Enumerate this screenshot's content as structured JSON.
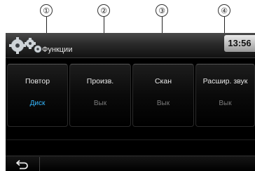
{
  "callouts": [
    "①",
    "②",
    "③",
    "④"
  ],
  "header": {
    "title": "Функции",
    "clock": "13:56"
  },
  "options": [
    {
      "label": "Повтор",
      "value": "Диск",
      "active": true
    },
    {
      "label": "Произв.",
      "value": "Вык",
      "active": false
    },
    {
      "label": "Скан",
      "value": "Вык",
      "active": false
    },
    {
      "label": "Расшир. звук",
      "value": "Вык",
      "active": false
    }
  ],
  "icons": {
    "header": "gear-icon",
    "back": "back-arrow-icon"
  },
  "colors": {
    "active_value": "#36b8ff",
    "inactive_value": "#7a7a7a"
  }
}
